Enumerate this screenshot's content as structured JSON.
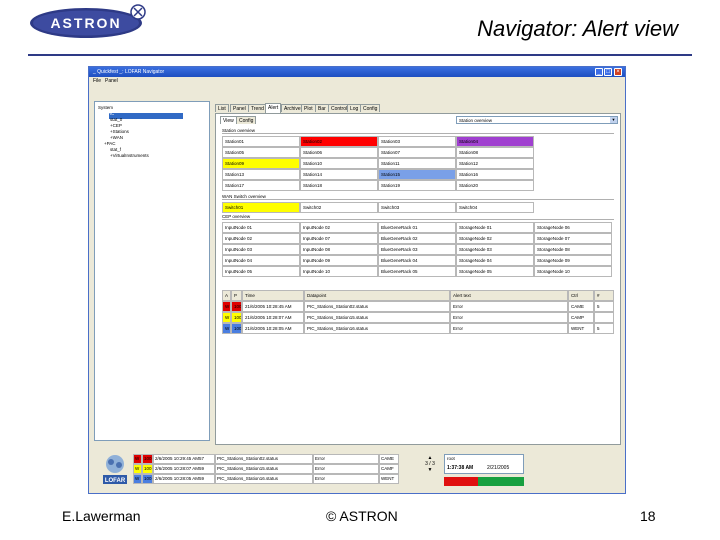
{
  "slide": {
    "title": "Navigator: Alert view",
    "logo_text": "ASTRON",
    "footer_author": "E.Lawerman",
    "footer_copyright": "© ASTRON",
    "footer_page": "18"
  },
  "window": {
    "title": "_ Quickfest _: LOFAR Navigator",
    "menu": [
      "File",
      "Panel"
    ],
    "buttons": [
      "_",
      "□",
      "×"
    ]
  },
  "tree": {
    "items": [
      {
        "label": "System",
        "indent": 0
      },
      {
        "label": "- PIC",
        "indent": 1
      },
      {
        "label": "stat_0",
        "indent": 2
      },
      {
        "label": "+CEP",
        "indent": 2
      },
      {
        "label": "+Stations",
        "indent": 2
      },
      {
        "label": "+WAN",
        "indent": 2
      },
      {
        "label": "+PAC",
        "indent": 1
      },
      {
        "label": "stat_f",
        "indent": 2
      },
      {
        "label": "+VirtualInstruments",
        "indent": 2
      }
    ]
  },
  "tabs": [
    "List",
    "Panel",
    "Trend",
    "Alert",
    "Archive",
    "Plot",
    "Bar",
    "Control",
    "Log",
    "Config"
  ],
  "active_tab": "Alert",
  "subtabs": [
    "View",
    "Config"
  ],
  "combo_value": "Station overview",
  "sections": {
    "stations": "Station overview",
    "wan": "WAN Switch overview",
    "cep": "CEP overview"
  },
  "station_grid": [
    [
      "Station01",
      "Station02",
      "Station03",
      "Station04"
    ],
    [
      "Station05",
      "Station06",
      "Station07",
      "Station08"
    ],
    [
      "Station09",
      "Station10",
      "Station11",
      "Station12"
    ],
    [
      "Station13",
      "Station14",
      "Station15",
      "Station16"
    ],
    [
      "Station17",
      "Station18",
      "Station19",
      "Station20"
    ]
  ],
  "station_colors": {
    "0-1": "#ff0000",
    "0-3": "#a040d0",
    "2-0": "#ffff00",
    "3-2": "#7aa0e8"
  },
  "wan_grid": [
    [
      "Switch01",
      "Switch02",
      "Switch03",
      "Switch04"
    ]
  ],
  "wan_colors": {
    "0-0": "#ffff00"
  },
  "cep_grid": [
    [
      "InputNode 01",
      "InputNode 02",
      "BlueGeneRack 01",
      "StorageNode 01",
      "StorageNode 06"
    ],
    [
      "InputNode 02",
      "InputNode 07",
      "BlueGeneRack 02",
      "StorageNode 02",
      "StorageNode 07"
    ],
    [
      "InputNode 03",
      "InputNode 08",
      "BlueGeneRack 03",
      "StorageNode 03",
      "StorageNode 08"
    ],
    [
      "InputNode 04",
      "InputNode 09",
      "BlueGeneRack 04",
      "StorageNode 04",
      "StorageNode 09"
    ],
    [
      "InputNode 05",
      "InputNode 10",
      "BlueGeneRack 05",
      "StorageNode 05",
      "StorageNode 10"
    ]
  ],
  "alert_table": {
    "headers": [
      "A",
      "P",
      "Time",
      "Datapoint",
      "Alert text",
      "Ctrl",
      "#"
    ],
    "rows": [
      {
        "a": "W",
        "p": "100",
        "time": "21/6/2005 10:28:45 AM",
        "dp": "PIC_Stations_Station02.status",
        "text": "Error",
        "ctrl": "CAME",
        "n": "5",
        "color": "#e00000"
      },
      {
        "a": "W",
        "p": "100",
        "time": "21/6/2005 10:28:07 AM",
        "dp": "PIC_Stations_Station15.status",
        "text": "Error",
        "ctrl": "CAMP",
        "n": "",
        "color": "#ffff00"
      },
      {
        "a": "W",
        "p": "100",
        "time": "21/6/2005 10:28:05 AM",
        "dp": "PIC_Stations_Station16.status",
        "text": "Error",
        "ctrl": "WENT",
        "n": "5",
        "color": "#4a7ee0"
      }
    ]
  },
  "status_strip": {
    "rows": [
      {
        "a": "W",
        "p": "100",
        "time": "2/6/2005 10:29:45 AM57",
        "dp": "PIC_Stations_Station02.status",
        "text": "Error",
        "ctrl": "CAME",
        "color": "#e00000"
      },
      {
        "a": "W",
        "p": "100",
        "time": "2/6/2005 10:28:07 AM59",
        "dp": "PIC_Stations_Station15.status",
        "text": "Error",
        "ctrl": "CAMF",
        "color": "#ffff00"
      },
      {
        "a": "W",
        "p": "100",
        "time": "2/6/2005 10:28:05 AM59",
        "dp": "PIC_Stations_Station16.status",
        "text": "Error",
        "ctrl": "WENT",
        "color": "#4a7ee0"
      }
    ],
    "clock_label": "root",
    "clock_time": "1:37:38 AM",
    "clock_date": "2/21/2005",
    "count_label": "3 / 3",
    "lofar_text": "LOFAR"
  }
}
